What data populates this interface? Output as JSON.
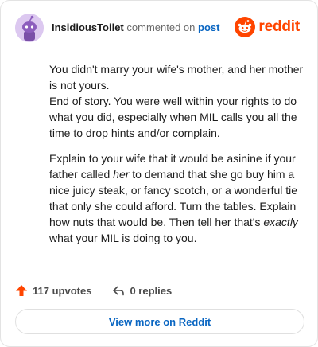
{
  "header": {
    "username": "InsidiousToilet",
    "verb": "commented on",
    "post_link": "post",
    "logo_text": "reddit",
    "avatar_icon": "snoo-avatar-icon",
    "logo_icon": "reddit-snoo-icon"
  },
  "body": {
    "paragraphs": [
      {
        "text": "You didn't marry your wife's mother, and her mother is not yours.\nEnd of story. You were well within your rights to do what you did, especially when MIL calls you all the time to drop hints and/or complain."
      },
      {
        "part1": "Explain to your wife that it would be asinine if your father called ",
        "em1": "her",
        "part2": " to demand that she go buy him a nice juicy steak, or fancy scotch, or a wonderful tie that only she could afford. Turn the tables. Explain how nuts that would be. Then tell her that's ",
        "em2": "exactly",
        "part3": " what your MIL is doing to you."
      }
    ]
  },
  "footer": {
    "upvotes": "117 upvotes",
    "replies": "0 replies",
    "upvote_icon": "upvote-arrow-icon",
    "reply_icon": "reply-arrow-icon"
  },
  "view_more_label": "View more on Reddit",
  "colors": {
    "brand": "#ff4500",
    "link": "#0a66c2",
    "avatar_bg": "#dcc8f0"
  }
}
